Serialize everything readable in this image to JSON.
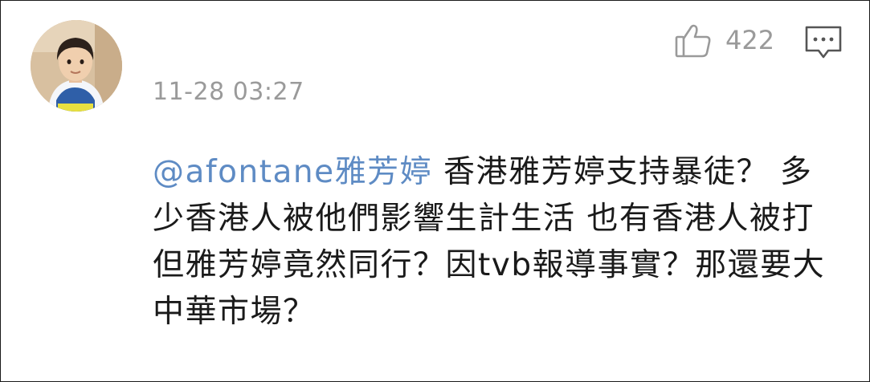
{
  "comment": {
    "timestamp": "11-28 03:27",
    "like_count": "422",
    "mention": "@afontane雅芳婷",
    "text": " 香港雅芳婷支持暴徒？ 多少香港人被他們影響生計生活 也有香港人被打 但雅芳婷竟然同行？因tvb報導事實？那還要大中華市場？",
    "icons": {
      "avatar": "user-avatar-photo",
      "like": "thumbs-up-icon",
      "reply": "comment-bubble-icon"
    },
    "colors": {
      "mention": "#5e8bc4",
      "meta": "#9a9a9a",
      "text": "#1a1a1a"
    }
  }
}
